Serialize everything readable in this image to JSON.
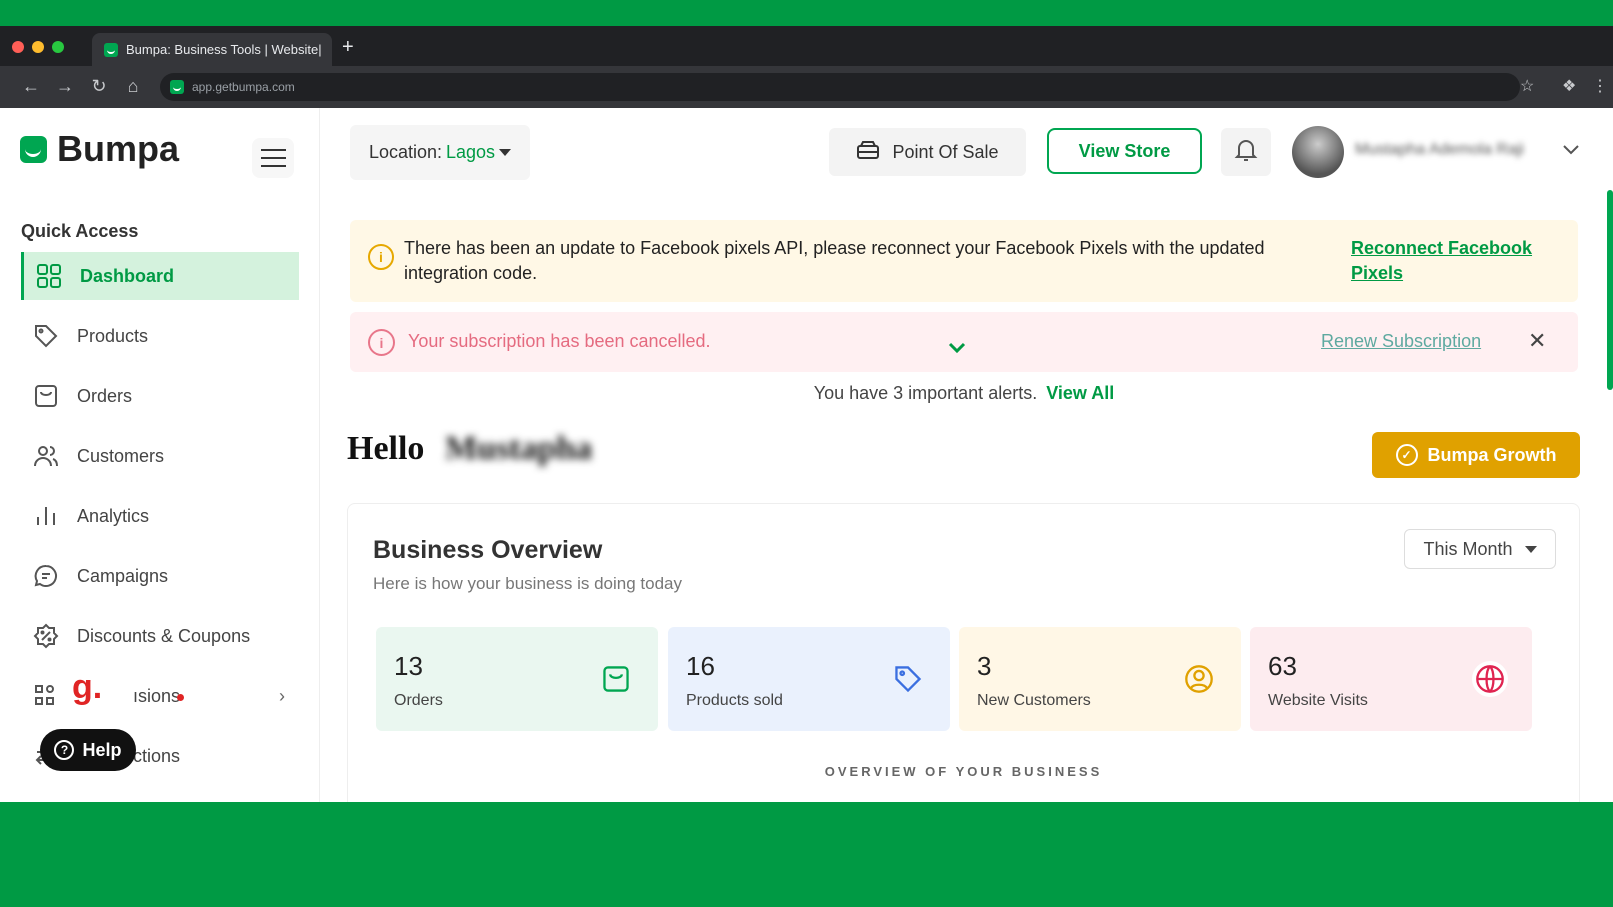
{
  "browser": {
    "tab_title": "Bumpa: Business Tools | Website|",
    "new_tab": "+",
    "url": "app.getbumpa.com"
  },
  "brand": {
    "name": "Bumpa"
  },
  "sidebar": {
    "heading": "Quick Access",
    "items": [
      {
        "label": "Dashboard",
        "icon": "grid-icon",
        "active": true
      },
      {
        "label": "Products",
        "icon": "tag-icon"
      },
      {
        "label": "Orders",
        "icon": "bag-icon"
      },
      {
        "label": "Customers",
        "icon": "users-icon"
      },
      {
        "label": "Analytics",
        "icon": "bar-chart-icon"
      },
      {
        "label": "Campaigns",
        "icon": "chat-icon"
      },
      {
        "label": "Discounts & Coupons",
        "icon": "percent-badge-icon"
      },
      {
        "label": "ısions",
        "icon": "apps-icon"
      },
      {
        "label": "ctions",
        "icon": "transfer-icon"
      }
    ],
    "help_label": "Help",
    "g_letter": "g."
  },
  "header": {
    "location_label": "Location:",
    "location_value": "Lagos",
    "pos_label": "Point Of Sale",
    "view_store_label": "View Store",
    "user_name": "Mustapha Ademola Raji"
  },
  "banners": {
    "pixel_text": "There has been an update to Facebook pixels API, please reconnect your Facebook Pixels with the updated integration code.",
    "pixel_link": "Reconnect Facebook Pixels",
    "subscription_text": "Your subscription has been cancelled.",
    "subscription_link": "Renew Subscription",
    "close": "✕",
    "alerts_text": "You have 3 important alerts.",
    "alerts_link": "View All"
  },
  "greeting": {
    "hello": "Hello",
    "name": "Mustapha"
  },
  "growth_button": "Bumpa Growth",
  "overview": {
    "title": "Business Overview",
    "subtitle": "Here is how your business is doing today",
    "period": "This Month",
    "stats": [
      {
        "value": "13",
        "label": "Orders",
        "bg": "#eaf7f0",
        "color": "#00a651",
        "icon": "bag-icon"
      },
      {
        "value": "16",
        "label": "Products sold",
        "bg": "#eaf1fd",
        "color": "#3b6fe0",
        "icon": "tag-icon"
      },
      {
        "value": "3",
        "label": "New Customers",
        "bg": "#fff7e6",
        "color": "#e0a100",
        "icon": "user-circle-icon"
      },
      {
        "value": "63",
        "label": "Website Visits",
        "bg": "#fdecef",
        "color": "#e02451",
        "icon": "globe-cursor-icon"
      }
    ],
    "footer": "OVERVIEW OF YOUR BUSINESS"
  },
  "colors": {
    "brand": "#00a651",
    "accent": "#e0a100",
    "danger": "#e8768a"
  }
}
